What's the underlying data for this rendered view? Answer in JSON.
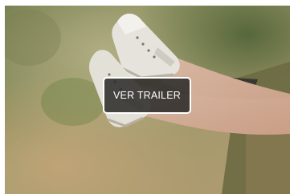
{
  "card": {
    "image_icon": "sneakers-photo",
    "trailer_button_label": "VER TRAILER"
  },
  "colors": {
    "button_background": "#2e2c2a",
    "button_border": "#ffffff",
    "button_text": "#ffffff"
  }
}
